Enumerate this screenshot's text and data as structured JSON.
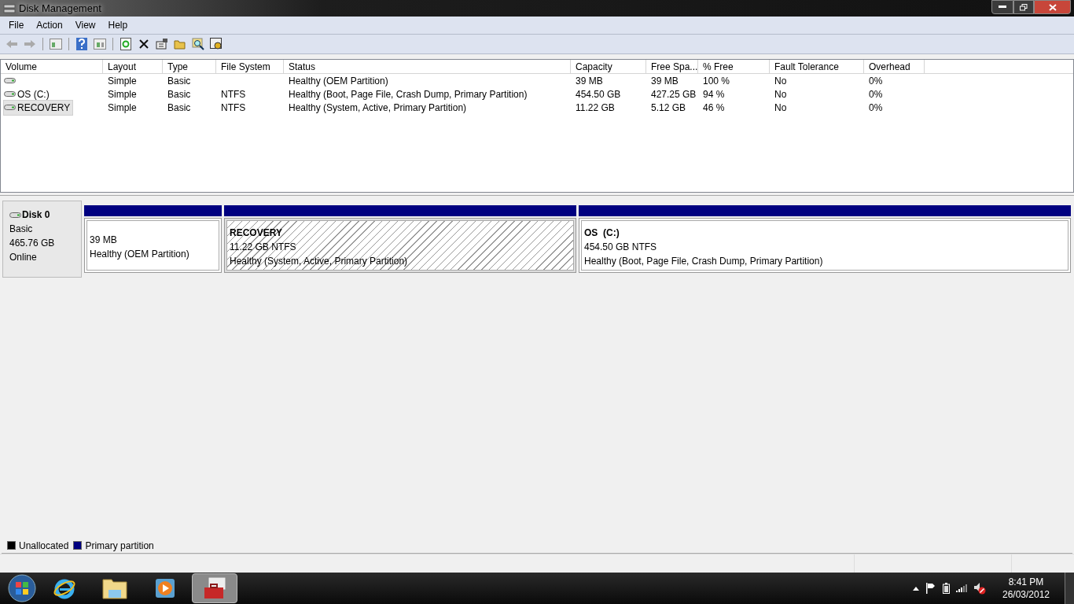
{
  "window": {
    "title": "Disk Management"
  },
  "menu": [
    "File",
    "Action",
    "View",
    "Help"
  ],
  "table": {
    "columns": [
      "Volume",
      "Layout",
      "Type",
      "File System",
      "Status",
      "Capacity",
      "Free Spa...",
      "% Free",
      "Fault Tolerance",
      "Overhead"
    ],
    "rows": [
      {
        "selected": false,
        "cells": [
          "",
          "Simple",
          "Basic",
          "",
          "Healthy (OEM Partition)",
          "39 MB",
          "39 MB",
          "100 %",
          "No",
          "0%"
        ]
      },
      {
        "selected": false,
        "cells": [
          "OS (C:)",
          "Simple",
          "Basic",
          "NTFS",
          "Healthy (Boot, Page File, Crash Dump, Primary Partition)",
          "454.50 GB",
          "427.25 GB",
          "94 %",
          "No",
          "0%"
        ]
      },
      {
        "selected": true,
        "cells": [
          "RECOVERY",
          "Simple",
          "Basic",
          "NTFS",
          "Healthy (System, Active, Primary Partition)",
          "11.22 GB",
          "5.12 GB",
          "46 %",
          "No",
          "0%"
        ]
      }
    ]
  },
  "disk": {
    "name": "Disk 0",
    "type": "Basic",
    "size": "465.76 GB",
    "state": "Online",
    "partitions": [
      {
        "selected": false,
        "size": "39 MB",
        "status": "Healthy (OEM Partition)"
      },
      {
        "selected": true,
        "name": "RECOVERY",
        "size": "11.22 GB NTFS",
        "status": "Healthy (System, Active, Primary Partition)"
      },
      {
        "selected": false,
        "name": "OS  (C:)",
        "size": "454.50 GB NTFS",
        "status": "Healthy (Boot, Page File, Crash Dump, Primary Partition)"
      }
    ]
  },
  "legend": [
    {
      "label": "Unallocated",
      "color": "#000000"
    },
    {
      "label": "Primary partition",
      "color": "#000080"
    }
  ],
  "clock": {
    "time": "8:41 PM",
    "date": "26/03/2012"
  }
}
